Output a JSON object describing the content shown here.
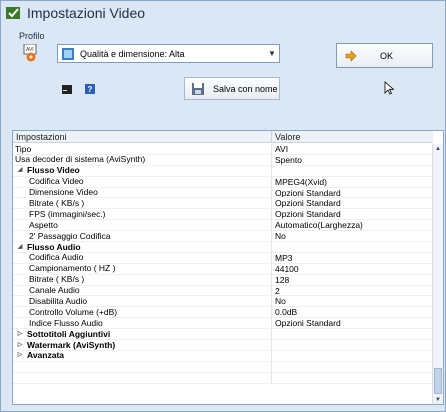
{
  "window": {
    "title": "Impostazioni Video"
  },
  "profile": {
    "label": "Profilo",
    "selected": "Qualità e dimensione: Alta"
  },
  "buttons": {
    "ok": "OK",
    "save_as": "Salva con nome"
  },
  "grid": {
    "columns": [
      "Impostazioni",
      "Valore"
    ],
    "rows": [
      {
        "name": "Tipo",
        "value": "AVI",
        "kind": "prop",
        "indent": 0
      },
      {
        "name": "Usa decoder di sistema (AviSynth)",
        "value": "Spento",
        "kind": "prop",
        "indent": 0
      },
      {
        "name": "Flusso Video",
        "value": "",
        "kind": "cat-open"
      },
      {
        "name": "Codifica Video",
        "value": "MPEG4(Xvid)",
        "kind": "prop",
        "indent": 1
      },
      {
        "name": "Dimensione Video",
        "value": "Opzioni Standard",
        "kind": "prop",
        "indent": 1
      },
      {
        "name": "Bitrate ( KB/s )",
        "value": "Opzioni Standard",
        "kind": "prop",
        "indent": 1
      },
      {
        "name": "FPS (immagini/sec.)",
        "value": "Opzioni Standard",
        "kind": "prop",
        "indent": 1
      },
      {
        "name": "Aspetto",
        "value": "Automatico(Larghezza)",
        "kind": "prop",
        "indent": 1
      },
      {
        "name": "2' Passaggio Codifica",
        "value": "No",
        "kind": "prop",
        "indent": 1
      },
      {
        "name": "Flusso Audio",
        "value": "",
        "kind": "cat-open"
      },
      {
        "name": "Codifica Audio",
        "value": "MP3",
        "kind": "prop",
        "indent": 1
      },
      {
        "name": "Campionamento ( HZ )",
        "value": "44100",
        "kind": "prop",
        "indent": 1
      },
      {
        "name": "Bitrate ( KB/s )",
        "value": "128",
        "kind": "prop",
        "indent": 1
      },
      {
        "name": "Canale Audio",
        "value": "2",
        "kind": "prop",
        "indent": 1
      },
      {
        "name": "Disabilita Audio",
        "value": "No",
        "kind": "prop",
        "indent": 1
      },
      {
        "name": "Controllo Volume (+dB)",
        "value": "0.0dB",
        "kind": "prop",
        "indent": 1
      },
      {
        "name": "Indice Flusso Audio",
        "value": "Opzioni Standard",
        "kind": "prop",
        "indent": 1
      },
      {
        "name": "Sottotitoli Aggiuntivi",
        "value": "",
        "kind": "cat-closed"
      },
      {
        "name": "Watermark (AviSynth)",
        "value": "",
        "kind": "cat-closed"
      },
      {
        "name": "Avanzata",
        "value": "",
        "kind": "cat-closed"
      },
      {
        "name": "",
        "value": "",
        "kind": "empty"
      },
      {
        "name": "",
        "value": "",
        "kind": "empty"
      }
    ]
  },
  "colors": {
    "background": "#dbe7f5",
    "accent": "#e8731a",
    "grid_border": "#8aa6c9"
  }
}
